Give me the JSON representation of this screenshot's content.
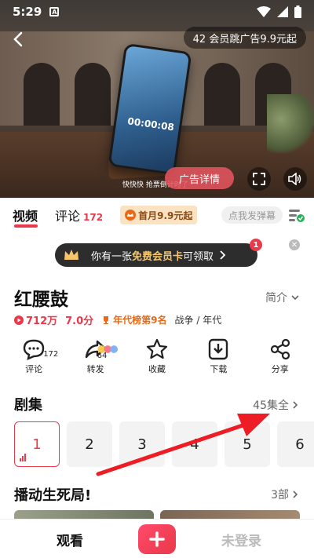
{
  "status_bar": {
    "time": "5:29"
  },
  "video": {
    "ad_pill": "42 会员跳广告9.9元起",
    "ad_detail_button": "广告详情",
    "subtitle": "快快快 抢票倒计时了",
    "clock_text": "00:00:08"
  },
  "tabs": [
    {
      "label": "视频",
      "active": true
    },
    {
      "label": "评论",
      "count": "172"
    }
  ],
  "vip_pill": "首月9.9元起",
  "danmu_placeholder": "点我发弹幕",
  "vip_banner": {
    "prefix": "你有一张",
    "highlight": "免费会员卡",
    "suffix": "可领取",
    "badge": "1"
  },
  "show": {
    "title": "红腰鼓",
    "intro_label": "简介",
    "plays": "712万",
    "score": "7.0分",
    "rank": "年代榜第9名",
    "genre": "战争 / 年代"
  },
  "actions": [
    {
      "icon": "comment-icon",
      "label": "评论",
      "count": "172"
    },
    {
      "icon": "share-arrow-icon",
      "label": "转发",
      "count": "64"
    },
    {
      "icon": "star-icon",
      "label": "收藏"
    },
    {
      "icon": "download-icon",
      "label": "下载"
    },
    {
      "icon": "share-nodes-icon",
      "label": "分享"
    }
  ],
  "episodes": {
    "title": "剧集",
    "more": "45集全",
    "items": [
      "1",
      "2",
      "3",
      "4",
      "5",
      "6"
    ]
  },
  "series": {
    "title": "播动生死局!",
    "more": "3部"
  },
  "bottom_bar": {
    "watch": "观看",
    "login": "未登录"
  },
  "colors": {
    "accent": "#e9394a",
    "gold": "#f6c66b"
  }
}
